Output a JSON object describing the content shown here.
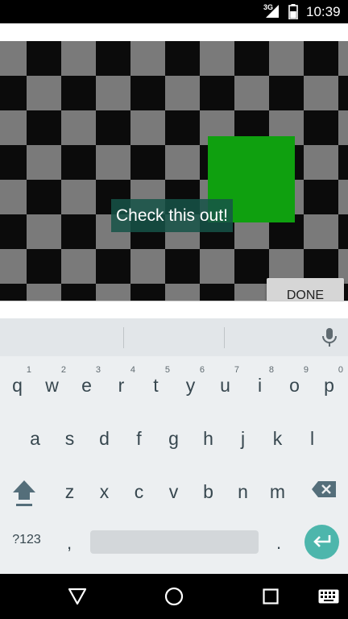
{
  "status_bar": {
    "network_label": "3G",
    "time": "10:39",
    "icons": [
      "signal-icon",
      "battery-icon"
    ]
  },
  "toast": {
    "text": "Check this out!"
  },
  "done_button": {
    "label": "DONE"
  },
  "keyboard": {
    "row1": [
      {
        "letter": "q",
        "hint": "1"
      },
      {
        "letter": "w",
        "hint": "2"
      },
      {
        "letter": "e",
        "hint": "3"
      },
      {
        "letter": "r",
        "hint": "4"
      },
      {
        "letter": "t",
        "hint": "5"
      },
      {
        "letter": "y",
        "hint": "6"
      },
      {
        "letter": "u",
        "hint": "7"
      },
      {
        "letter": "i",
        "hint": "8"
      },
      {
        "letter": "o",
        "hint": "9"
      },
      {
        "letter": "p",
        "hint": "0"
      }
    ],
    "row2": [
      "a",
      "s",
      "d",
      "f",
      "g",
      "h",
      "j",
      "k",
      "l"
    ],
    "row3": [
      "z",
      "x",
      "c",
      "v",
      "b",
      "n",
      "m"
    ],
    "symbols_label": "?123",
    "comma_label": ",",
    "period_label": ".",
    "accent_color": "#4db6ac"
  },
  "colors": {
    "green_square": "#0fa00f",
    "board_dark": "#0b0b0b",
    "board_light": "#7a7a7a"
  },
  "nav_bar": {
    "icons": [
      "back-icon",
      "home-icon",
      "recents-icon",
      "keyboard-switch-icon"
    ]
  }
}
